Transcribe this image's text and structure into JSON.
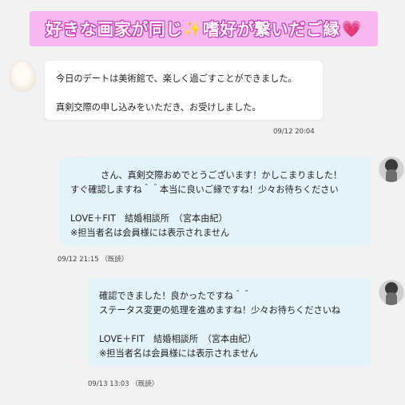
{
  "banner": {
    "text_part1": "好きな画家が同じ",
    "sparkle": "✨",
    "text_part2": "嗜好が繋いだご縁",
    "heart": "💗"
  },
  "messages": [
    {
      "side": "left",
      "lines": "今日のデートは美術館で、楽しく過ごすことができました。",
      "lines2": "真剣交際の申し込みをいただき、お受けしました。",
      "timestamp": "09/12 20:04",
      "avatar": "member-avatar"
    },
    {
      "side": "right",
      "body": "さん、真剣交際おめでとうございます！かしこまりました！\nすぐ確認しますね＾＾本当に良いご縁ですね！少々お待ちください",
      "signature": "LOVE＋FIT　結婚相談所　（宮本由紀）\n※担当者名は会員様には表示されません",
      "timestamp": "09/12 21:15 （既読）",
      "avatar": "counselor-avatar"
    },
    {
      "side": "right",
      "body": "確認できました！良かったですね＾＾\nステータス変更の処理を進めますね！少々お待ちくださいね",
      "signature": "LOVE＋FIT　結婚相談所　（宮本由紀）\n※担当者名は会員様には表示されません",
      "timestamp": "09/13 13:03 （既読）",
      "avatar": "counselor-avatar"
    }
  ]
}
